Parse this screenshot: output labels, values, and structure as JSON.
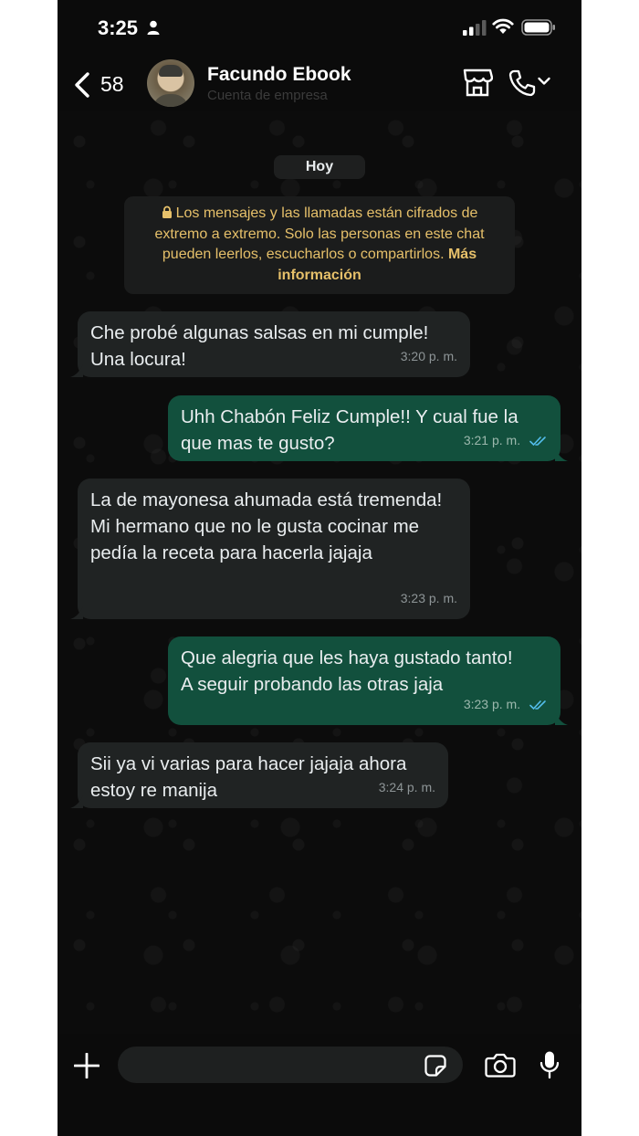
{
  "status_bar": {
    "time": "3:25"
  },
  "header": {
    "back_count": "58",
    "contact_name": "Facundo Ebook",
    "contact_subtitle": "Cuenta de empresa"
  },
  "chat": {
    "day_label": "Hoy",
    "encryption_notice": "Los mensajes y las llamadas están cifrados de extremo a extremo. Solo las personas en este chat pueden leerlos, escucharlos o compartirlos.",
    "encryption_link": "Más información",
    "messages": [
      {
        "direction": "incoming",
        "text": "Che probé algunas salsas en mi cumple!\nUna locura!",
        "time": "3:20 p. m."
      },
      {
        "direction": "outgoing",
        "text": "Uhh Chabón Feliz Cumple!! Y cual fue la que mas te gusto?",
        "time": "3:21 p. m.",
        "read": true
      },
      {
        "direction": "incoming",
        "text": "La de mayonesa ahumada está tremenda!\nMi hermano que no le gusta cocinar me pedía la receta para hacerla jajaja",
        "time": "3:23 p. m."
      },
      {
        "direction": "outgoing",
        "text": "Que alegria que les haya gustado tanto!\nA seguir probando las otras jaja",
        "time": "3:23 p. m.",
        "read": true
      },
      {
        "direction": "incoming",
        "text": "Sii ya vi varias para hacer jajaja ahora estoy re manija",
        "time": "3:24 p. m."
      }
    ]
  },
  "composer": {
    "value": "",
    "placeholder": ""
  },
  "colors": {
    "incoming_bubble": "#202323",
    "outgoing_bubble": "#12503d",
    "read_ticks": "#53bdeb",
    "encryption_text": "#e6c06a"
  },
  "icons": [
    "person-icon",
    "signal-icon",
    "wifi-icon",
    "battery-icon",
    "back-chevron-icon",
    "shop-icon",
    "phone-icon",
    "chevron-down-icon",
    "lock-icon",
    "double-check-icon",
    "plus-icon",
    "sticker-icon",
    "camera-icon",
    "microphone-icon"
  ]
}
